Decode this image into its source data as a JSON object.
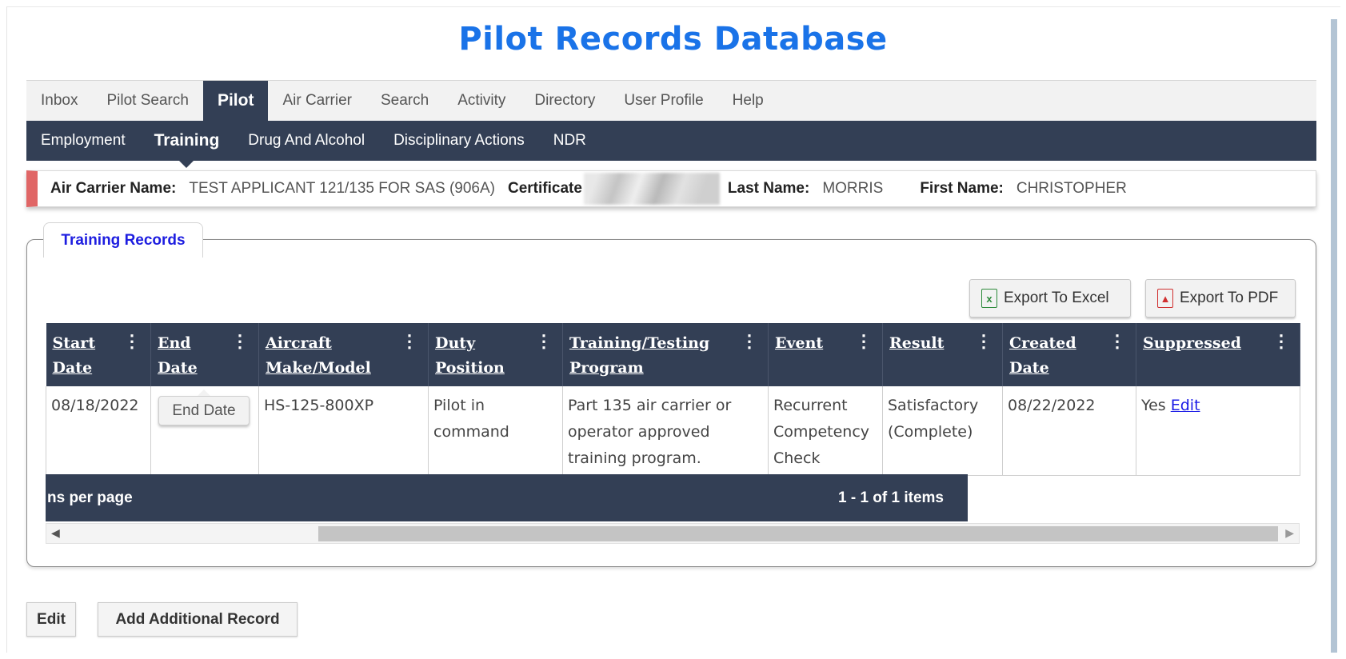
{
  "header": {
    "title": "Pilot Records Database"
  },
  "nav_primary": {
    "items": [
      {
        "label": "Inbox"
      },
      {
        "label": "Pilot Search"
      },
      {
        "label": "Pilot"
      },
      {
        "label": "Air Carrier"
      },
      {
        "label": "Search"
      },
      {
        "label": "Activity"
      },
      {
        "label": "Directory"
      },
      {
        "label": "User Profile"
      },
      {
        "label": "Help"
      }
    ],
    "active": "Pilot"
  },
  "nav_secondary": {
    "items": [
      {
        "label": "Employment"
      },
      {
        "label": "Training"
      },
      {
        "label": "Drug And Alcohol"
      },
      {
        "label": "Disciplinary Actions"
      },
      {
        "label": "NDR"
      }
    ],
    "active": "Training"
  },
  "info_bar": {
    "air_carrier_label": "Air Carrier Name:",
    "air_carrier_value": "TEST APPLICANT 121/135 FOR SAS (906A)",
    "certificate_label": "Certificate",
    "last_name_label": "Last Name:",
    "last_name_value": "MORRIS",
    "first_name_label": "First Name:",
    "first_name_value": "CHRISTOPHER",
    "accent_color": "#e06666"
  },
  "section": {
    "legend": "Training Records"
  },
  "toolbar": {
    "export_excel": "Export To Excel",
    "export_pdf": "Export To PDF"
  },
  "grid": {
    "columns": [
      {
        "label": "Start Date"
      },
      {
        "label": "End Date"
      },
      {
        "label": "Aircraft Make/Model"
      },
      {
        "label": "Duty Position"
      },
      {
        "label": "Training/Testing Program"
      },
      {
        "label": "Event"
      },
      {
        "label": "Result"
      },
      {
        "label": "Created Date"
      },
      {
        "label": "Suppressed"
      }
    ],
    "rows": [
      {
        "start_date": "08/18/2022",
        "end_date": "",
        "aircraft": "HS-125-800XP",
        "duty_position": "Pilot in command",
        "program": "Part 135 air carrier or operator approved training program.",
        "event": "Recurrent Competency Check",
        "result": "Satisfactory (Complete)",
        "created_date": "08/22/2022",
        "suppressed": "Yes",
        "edit_link": "Edit"
      }
    ],
    "tooltip": "End Date",
    "pager_left": "ns per page",
    "pager_right": "1 - 1 of 1 items",
    "header_color": "#333f55"
  },
  "actions": {
    "edit": "Edit",
    "add": "Add Additional Record"
  },
  "icons": {
    "excel": "excel-file-icon",
    "pdf": "pdf-file-icon",
    "kebab": "kebab-menu-icon"
  }
}
